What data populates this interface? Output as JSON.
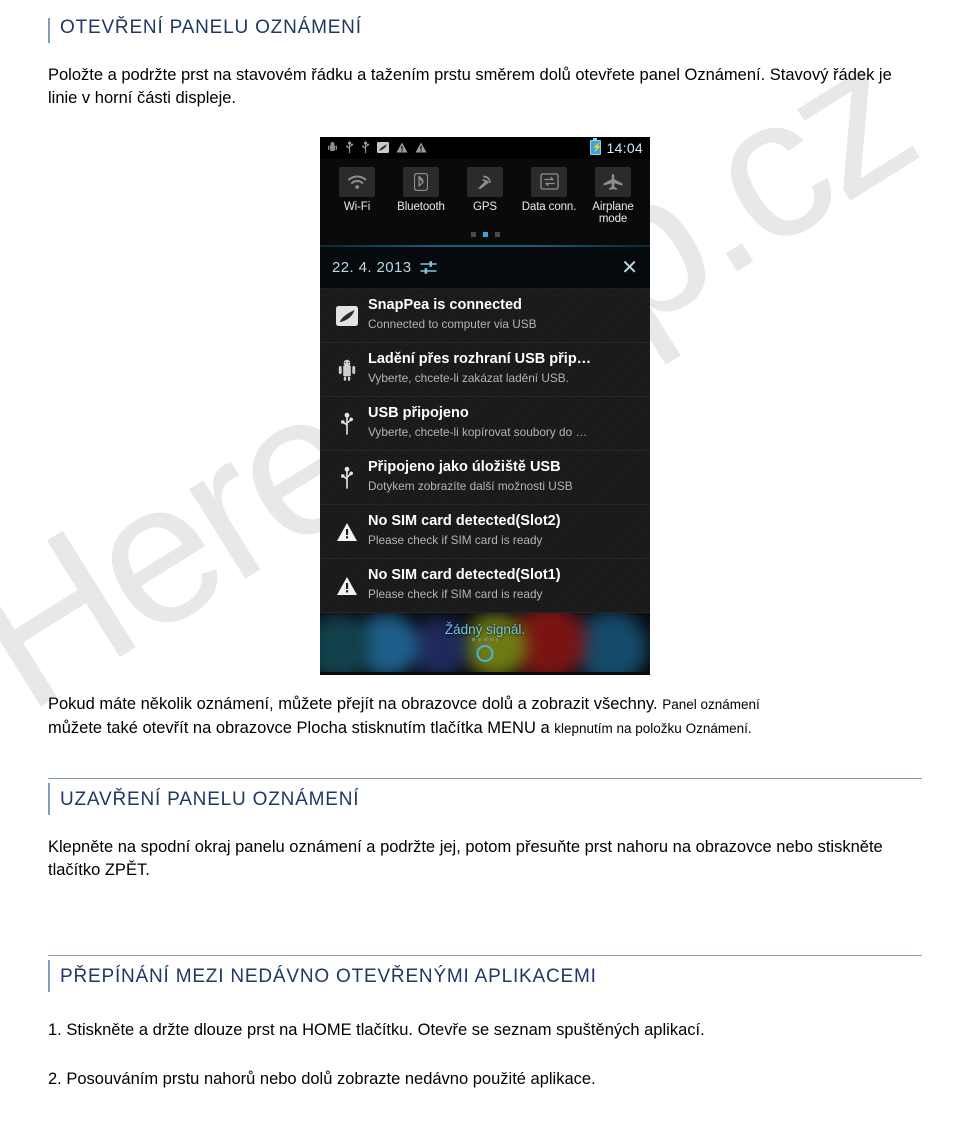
{
  "watermark": {
    "text": "Hereshop.cz"
  },
  "sections": [
    {
      "id": "open-panel",
      "heading": "OTEVŘENÍ PANELU OZNÁMENÍ",
      "paragraph_main": "Položte a podržte prst na stavovém řádku a tažením prstu směrem dolů otevřete panel Oznámení. Stavový řádek je linie v horní části displeje."
    },
    {
      "id": "close-panel",
      "heading": "UZAVŘENÍ PANELU OZNÁMENÍ",
      "paragraph_main": "Klepněte na spodní okraj panelu oznámení a podržte jej, potom přesuňte prst nahoru na obrazovce nebo stiskněte tlačítko ZPĚT."
    },
    {
      "id": "switch-apps",
      "heading": "PŘEPÍNÁNÍ MEZI NEDÁVNO OTEVŘENÝMI APLIKACEMI",
      "steps": [
        {
          "num": "1.",
          "big": "Stiskněte a držte dlouze prst na HOME tlačítku.",
          "small": "Otevře se seznam spuštěných aplikací."
        },
        {
          "num": "2.",
          "small_lead": "Posouváním prstu",
          "big": "nahorů nebo dolů",
          "small": "zobrazte nedávno použité aplikace."
        }
      ]
    }
  ],
  "mid_paragraph": {
    "big": "Pokud máte několik oznámení, můžete přejít na obrazovce dolů a zobrazit všechny.",
    "small": "Panel oznámení",
    "line2_big": "můžete také otevřít na obrazovce Plocha stisknutím tlačítka MENU a",
    "line2_small": "klepnutím na položku Oznámení."
  },
  "phone": {
    "statusbar": {
      "icons": [
        "android-debug-icon",
        "usb-icon",
        "usb-icon",
        "snappea-icon",
        "warning-icon",
        "warning-icon"
      ],
      "battery_icon": "battery-charging-icon",
      "time": "14:04"
    },
    "toggles": [
      {
        "label": "Wi-Fi",
        "icon": "wifi-icon"
      },
      {
        "label": "Bluetooth",
        "icon": "bluetooth-icon"
      },
      {
        "label": "GPS",
        "icon": "gps-icon"
      },
      {
        "label": "Data conn.",
        "icon": "data-connection-icon"
      },
      {
        "label": "Airplane\nmode",
        "icon": "airplane-icon"
      }
    ],
    "page_dots": {
      "count": 3,
      "active_index": 1
    },
    "date_row": {
      "date": "22. 4. 2013",
      "settings_icon": "sliders-icon",
      "close_icon": "close-icon",
      "close_label": "✕"
    },
    "notifications": [
      {
        "icon": "snappea-icon",
        "title": "SnapPea is connected",
        "sub": "Connected to computer via USB"
      },
      {
        "icon": "android-icon",
        "title": "Ladění přes rozhraní USB přip…",
        "sub": "Vyberte, chcete-li zakázat ladění USB."
      },
      {
        "icon": "usb-icon",
        "title": "USB připojeno",
        "sub": "Vyberte, chcete-li kopírovat soubory do …"
      },
      {
        "icon": "usb-icon",
        "title": "Připojeno jako úložiště USB",
        "sub": "Dotykem zobrazíte další možnosti USB"
      },
      {
        "icon": "warning-icon",
        "title": "No SIM card detected(Slot2)",
        "sub": "Please check if SIM card is ready"
      },
      {
        "icon": "warning-icon",
        "title": "No SIM card detected(Slot1)",
        "sub": "Please check if SIM card is ready"
      }
    ],
    "home_strip": {
      "label": "Žádný signál.",
      "handle_icon": "drag-handle-icon"
    }
  },
  "colors": {
    "heading": "#1f3864",
    "rule": "#7f9db9",
    "accent_blue": "#35a8d8",
    "watermark": "#e8e8e8"
  }
}
